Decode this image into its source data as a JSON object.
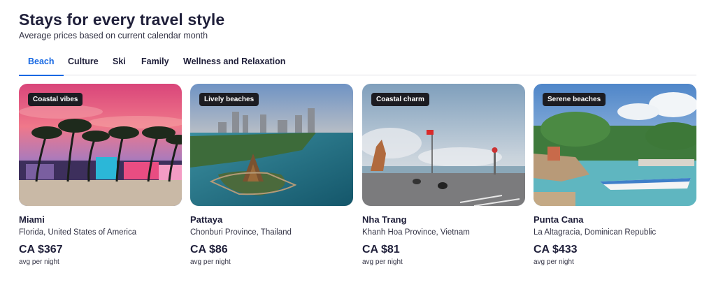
{
  "header": {
    "title": "Stays for every travel style",
    "subtitle": "Average prices based on current calendar month"
  },
  "tabs": [
    {
      "label": "Beach",
      "active": true
    },
    {
      "label": "Culture",
      "active": false
    },
    {
      "label": "Ski",
      "active": false
    },
    {
      "label": "Family",
      "active": false
    },
    {
      "label": "Wellness and Relaxation",
      "active": false
    }
  ],
  "colors": {
    "accent": "#1668e3",
    "badge_bg": "#1c1c22"
  },
  "cards": [
    {
      "badge": "Coastal vibes",
      "name": "Miami",
      "region": "Florida, United States of America",
      "price": "CA $367",
      "unit": "avg per night"
    },
    {
      "badge": "Lively beaches",
      "name": "Pattaya",
      "region": "Chonburi Province, Thailand",
      "price": "CA $86",
      "unit": "avg per night"
    },
    {
      "badge": "Coastal charm",
      "name": "Nha Trang",
      "region": "Khanh Hoa Province, Vietnam",
      "price": "CA $81",
      "unit": "avg per night"
    },
    {
      "badge": "Serene beaches",
      "name": "Punta Cana",
      "region": "La Altagracia, Dominican Republic",
      "price": "CA $433",
      "unit": "avg per night"
    }
  ]
}
